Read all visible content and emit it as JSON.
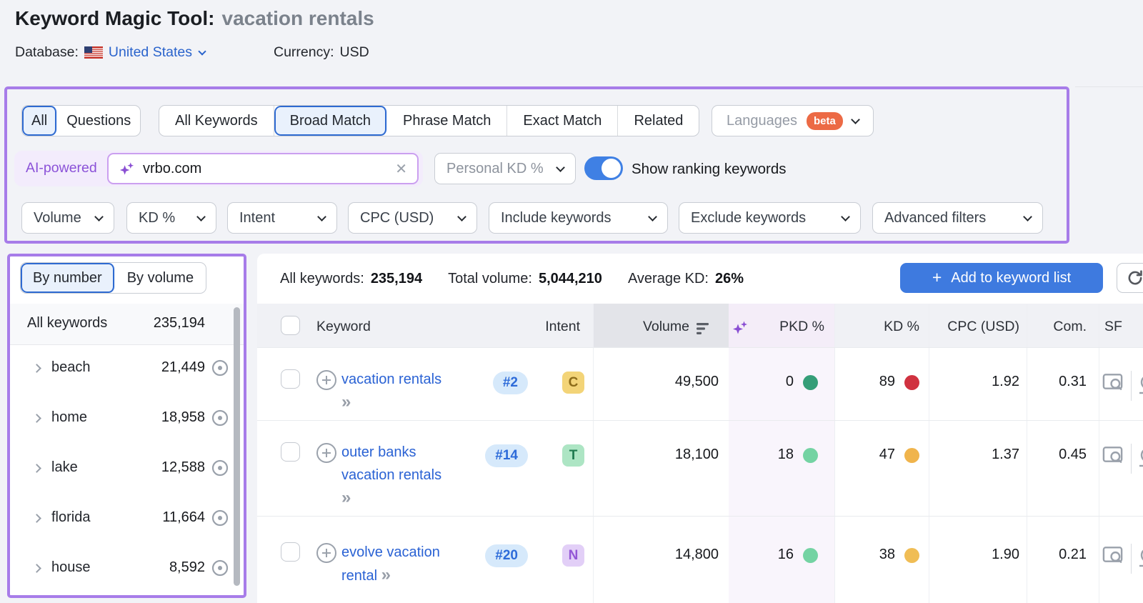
{
  "header": {
    "title": "Keyword Magic Tool:",
    "query": "vacation rentals",
    "database_label": "Database:",
    "database_value": "United States",
    "currency_label": "Currency:",
    "currency_value": "USD"
  },
  "filters": {
    "scope_tabs": [
      {
        "label": "All",
        "selected": true
      },
      {
        "label": "Questions",
        "selected": false
      }
    ],
    "match_tabs": [
      {
        "label": "All Keywords",
        "selected": false
      },
      {
        "label": "Broad Match",
        "selected": true
      },
      {
        "label": "Phrase Match",
        "selected": false
      },
      {
        "label": "Exact Match",
        "selected": false
      },
      {
        "label": "Related",
        "selected": false
      }
    ],
    "languages": {
      "label": "Languages",
      "badge": "beta"
    },
    "ai_label": "AI-powered",
    "search_value": "vrbo.com",
    "personal_kd_label": "Personal KD %",
    "toggle_label": "Show ranking keywords",
    "toggle_on": true,
    "dropdowns": [
      "Volume",
      "KD %",
      "Intent",
      "CPC (USD)",
      "Include keywords",
      "Exclude keywords",
      "Advanced filters"
    ]
  },
  "sidebar": {
    "tabs": [
      {
        "label": "By number",
        "selected": true
      },
      {
        "label": "By volume",
        "selected": false
      }
    ],
    "all_row": {
      "label": "All keywords",
      "count": "235,194"
    },
    "groups": [
      {
        "label": "beach",
        "count": "21,449"
      },
      {
        "label": "home",
        "count": "18,958"
      },
      {
        "label": "lake",
        "count": "12,588"
      },
      {
        "label": "florida",
        "count": "11,664"
      },
      {
        "label": "house",
        "count": "8,592"
      }
    ]
  },
  "summary": {
    "all_keywords_label": "All keywords:",
    "all_keywords_value": "235,194",
    "total_volume_label": "Total volume:",
    "total_volume_value": "5,044,210",
    "average_kd_label": "Average KD:",
    "average_kd_value": "26%",
    "add_button_label": "Add to keyword list"
  },
  "table": {
    "headers": {
      "keyword": "Keyword",
      "intent": "Intent",
      "volume": "Volume",
      "pkd": "PKD %",
      "kd": "KD %",
      "cpc": "CPC (USD)",
      "com": "Com.",
      "sf": "SF"
    },
    "intent_colors": {
      "C": {
        "bg": "#f3d478",
        "fg": "#8d6c1a"
      },
      "T": {
        "bg": "#ade5c4",
        "fg": "#1f7a50"
      },
      "N": {
        "bg": "#e2cff7",
        "fg": "#9456d6"
      }
    },
    "rows": [
      {
        "keyword": "vacation rentals",
        "rank": "#2",
        "intent": "C",
        "volume": "49,500",
        "pkd": "0",
        "pkd_dot": "#359e78",
        "kd": "89",
        "kd_dot": "#d03240",
        "cpc": "1.92",
        "com": "0.31"
      },
      {
        "keyword": "outer banks vacation rentals",
        "rank": "#14",
        "intent": "T",
        "volume": "18,100",
        "pkd": "18",
        "pkd_dot": "#74d3a3",
        "kd": "47",
        "kd_dot": "#f0b44c",
        "cpc": "1.37",
        "com": "0.45"
      },
      {
        "keyword": "evolve vacation rental",
        "rank": "#20",
        "intent": "N",
        "volume": "14,800",
        "pkd": "16",
        "pkd_dot": "#74d3a3",
        "kd": "38",
        "kd_dot": "#f0bd55",
        "cpc": "1.90",
        "com": "0.21"
      }
    ]
  },
  "icons": {
    "clear_glyph": "✕",
    "plus_glyph": "+",
    "expand_glyph": "»",
    "sparkle": "four-point-star",
    "eye": "visibility-eye",
    "refresh": "refresh-arrow",
    "sf": "serp-features-preview",
    "sort": "sort-descending"
  },
  "colors": {
    "purple_border": "#a77ce9",
    "accent_blue": "#2e6ad1",
    "button_blue": "#3e7adf",
    "link_blue": "#2a62d4",
    "beta_orange": "#ec6a45",
    "ai_purple": "#8b52d8",
    "toggle_blue": "#3f80e4"
  }
}
